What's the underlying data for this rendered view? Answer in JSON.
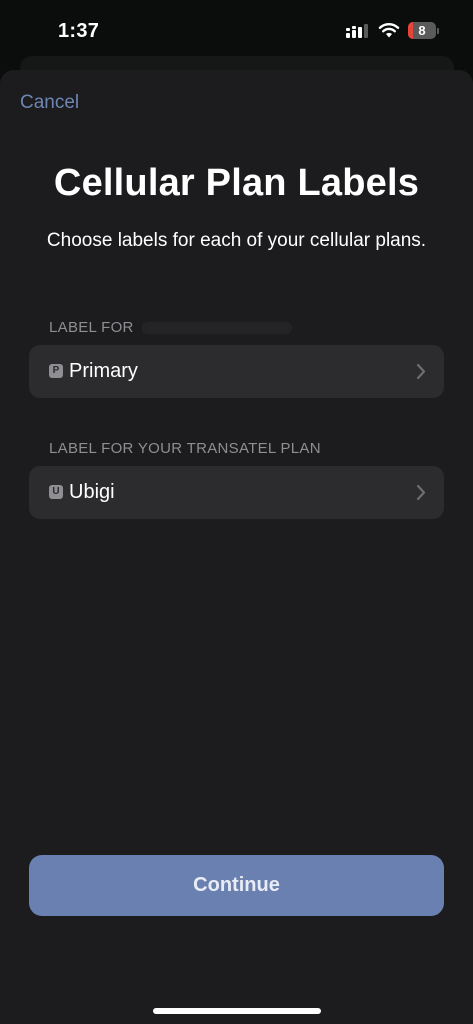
{
  "status_bar": {
    "time": "1:37",
    "battery_level": "8",
    "battery_fraction": 0.08,
    "signal_icon": "cellular-signal-icon",
    "wifi_icon": "wifi-icon"
  },
  "sheet": {
    "cancel_label": "Cancel",
    "title": "Cellular Plan Labels",
    "subtitle": "Choose labels for each of your cellular plans."
  },
  "plans": [
    {
      "header": "LABEL FOR",
      "badge": "P",
      "label": "Primary",
      "icon": "chevron-right-icon"
    },
    {
      "header": "LABEL FOR YOUR TRANSATEL PLAN",
      "badge": "U",
      "label": "Ubigi",
      "icon": "chevron-right-icon"
    }
  ],
  "footer": {
    "continue_label": "Continue"
  },
  "colors": {
    "accent": "#6e86b4",
    "button_bg": "#6a80b0",
    "row_bg": "#2c2c2e",
    "sheet_bg": "#1c1c1e",
    "battery_low": "#e5443b"
  }
}
